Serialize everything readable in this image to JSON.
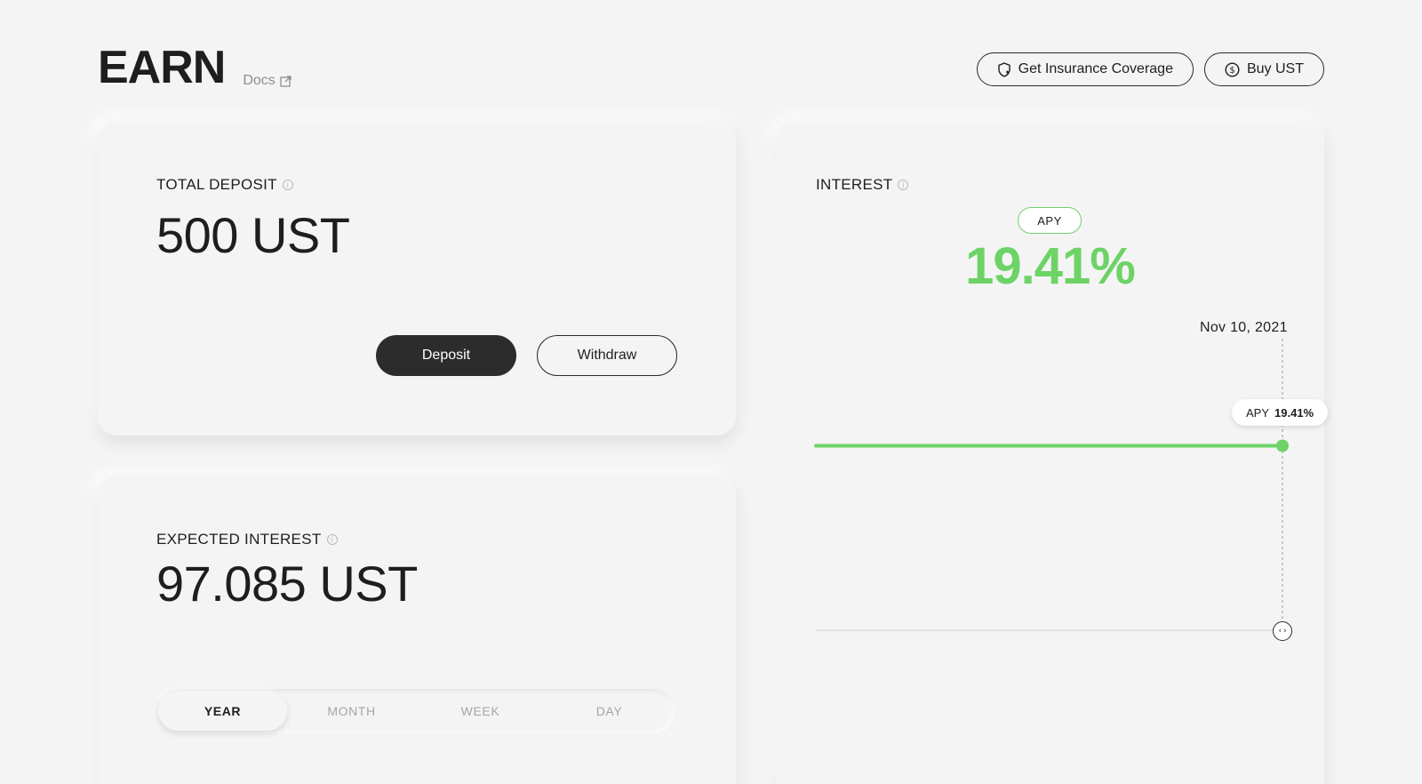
{
  "header": {
    "title": "EARN",
    "docs_label": "Docs",
    "insurance_label": "Get Insurance Coverage",
    "buy_label": "Buy UST"
  },
  "deposit": {
    "label": "TOTAL DEPOSIT",
    "value": "500 UST",
    "deposit_button": "Deposit",
    "withdraw_button": "Withdraw"
  },
  "expected": {
    "label": "EXPECTED INTEREST",
    "value": "97.085 UST",
    "tabs": [
      "YEAR",
      "MONTH",
      "WEEK",
      "DAY"
    ],
    "active_tab": "YEAR"
  },
  "interest": {
    "label": "INTEREST",
    "apy_label": "APY",
    "apy_value": "19.41%",
    "chart_date": "Nov 10, 2021",
    "tooltip_label": "APY",
    "tooltip_value": "19.41%",
    "line_color": "#6dd366"
  },
  "chart_data": {
    "type": "line",
    "title": "",
    "xlabel": "",
    "ylabel": "",
    "series": [
      {
        "values": [
          19.41,
          19.41,
          19.41,
          19.41,
          19.41,
          19.41,
          19.41
        ]
      }
    ],
    "highlight": {
      "x": "Nov 10, 2021",
      "y": 19.41
    },
    "grid": false,
    "legend": "none"
  },
  "colors": {
    "accent_green": "#6dd366",
    "primary_dark": "#2c2c2c",
    "background": "#f4f4f4"
  }
}
